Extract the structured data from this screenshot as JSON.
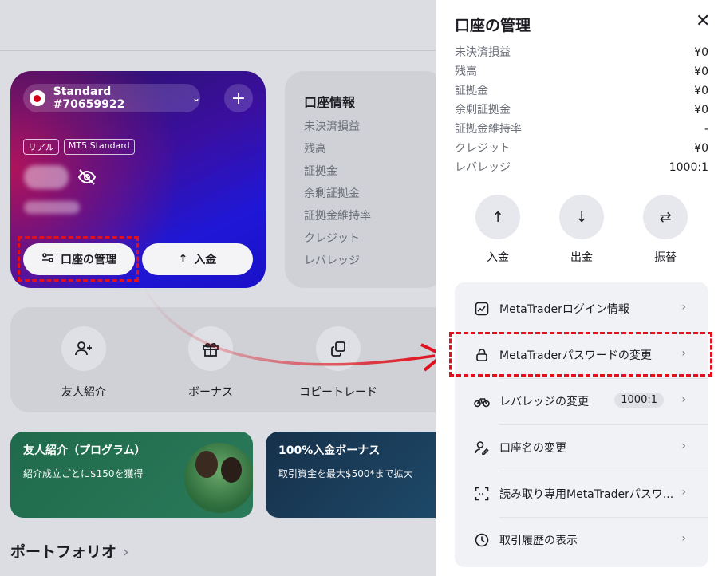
{
  "account": {
    "name": "Standard #70659922",
    "badge_real": "リアル",
    "badge_type": "MT5 Standard",
    "btn_manage": "口座の管理",
    "btn_deposit": "入金"
  },
  "info": {
    "title": "口座情報",
    "rows": [
      "未決済損益",
      "残高",
      "証拠金",
      "余剰証拠金",
      "証拠金維持率",
      "クレジット",
      "レバレッジ"
    ]
  },
  "quick": {
    "referral": "友人紹介",
    "bonus": "ボーナス",
    "copy": "コピートレード"
  },
  "promos": [
    {
      "title": "友人紹介（プログラム）",
      "sub": "紹介成立ごとに$150を獲得"
    },
    {
      "title": "100%入金ボーナス",
      "sub": "取引資金を最大$500*まで拡大"
    }
  ],
  "portfolio": {
    "title": "ポートフォリオ",
    "chev": "›"
  },
  "panel": {
    "title": "口座の管理",
    "close": "✕",
    "stats": [
      {
        "k": "未決済損益",
        "v": "¥0"
      },
      {
        "k": "残高",
        "v": "¥0"
      },
      {
        "k": "証拠金",
        "v": "¥0"
      },
      {
        "k": "余剰証拠金",
        "v": "¥0"
      },
      {
        "k": "証拠金維持率",
        "v": "-"
      },
      {
        "k": "クレジット",
        "v": "¥0"
      },
      {
        "k": "レバレッジ",
        "v": "1000:1"
      }
    ],
    "actions": {
      "deposit": "入金",
      "withdraw": "出金",
      "transfer": "振替"
    },
    "menu": {
      "login": "MetaTraderログイン情報",
      "password": "MetaTraderパスワードの変更",
      "leverage": "レバレッジの変更",
      "leverage_value": "1000:1",
      "rename": "口座名の変更",
      "readonly": "読み取り専用MetaTraderパスワ...",
      "history": "取引履歴の表示"
    }
  },
  "colors": {
    "highlight": "#e0101c",
    "panel_bg": "#ffffff"
  }
}
